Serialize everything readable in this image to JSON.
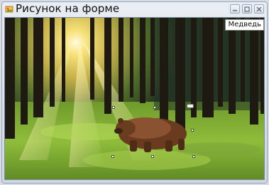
{
  "window": {
    "title": "Рисунок на форме",
    "icon": "picture-icon"
  },
  "controls": {
    "minimize_icon": "minimize-icon",
    "maximize_icon": "maximize-icon",
    "close_icon": "close-icon"
  },
  "canvas": {
    "label_text": "Медведь",
    "scene": "forest-with-sunlight",
    "object": "bear-image"
  }
}
